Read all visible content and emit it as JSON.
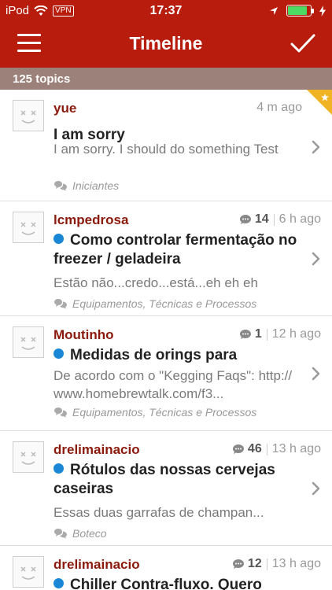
{
  "status_bar": {
    "carrier": "iPod",
    "vpn": "VPN",
    "time": "17:37",
    "battery_level": 0.85
  },
  "nav": {
    "title": "Timeline"
  },
  "topic_count": "125 topics",
  "topics": [
    {
      "user": "yue",
      "posts": "",
      "age": "4 m ago",
      "unread_dot": false,
      "title": "I am sorry",
      "excerpt": "I am sorry. I should do something Test",
      "category": "Iniciantes",
      "starred": true
    },
    {
      "user": "lcmpedrosa",
      "posts": "14",
      "age": "6 h ago",
      "unread_dot": true,
      "title": "Como controlar fermentação no freezer / geladeira",
      "excerpt": "Estão não...credo...está...eh eh eh",
      "category": "Equipamentos, Técnicas e Processos",
      "starred": false
    },
    {
      "user": "Moutinho",
      "posts": "1",
      "age": "12 h ago",
      "unread_dot": true,
      "title": "Medidas de orings para",
      "excerpt": "De acordo com o \"Kegging Faqs\": http://www.homebrewtalk.com/f3...",
      "category": "Equipamentos, Técnicas e Processos",
      "starred": false
    },
    {
      "user": "drelimainacio",
      "posts": "46",
      "age": "13 h ago",
      "unread_dot": true,
      "title": "Rótulos das nossas cervejas caseiras",
      "excerpt": "Essas duas garrafas de champan...",
      "category": "Boteco",
      "starred": false
    },
    {
      "user": "drelimainacio",
      "posts": "12",
      "age": "13 h ago",
      "unread_dot": true,
      "title": "Chiller Contra-fluxo. Quero",
      "excerpt": "",
      "category": "",
      "starred": false
    }
  ]
}
